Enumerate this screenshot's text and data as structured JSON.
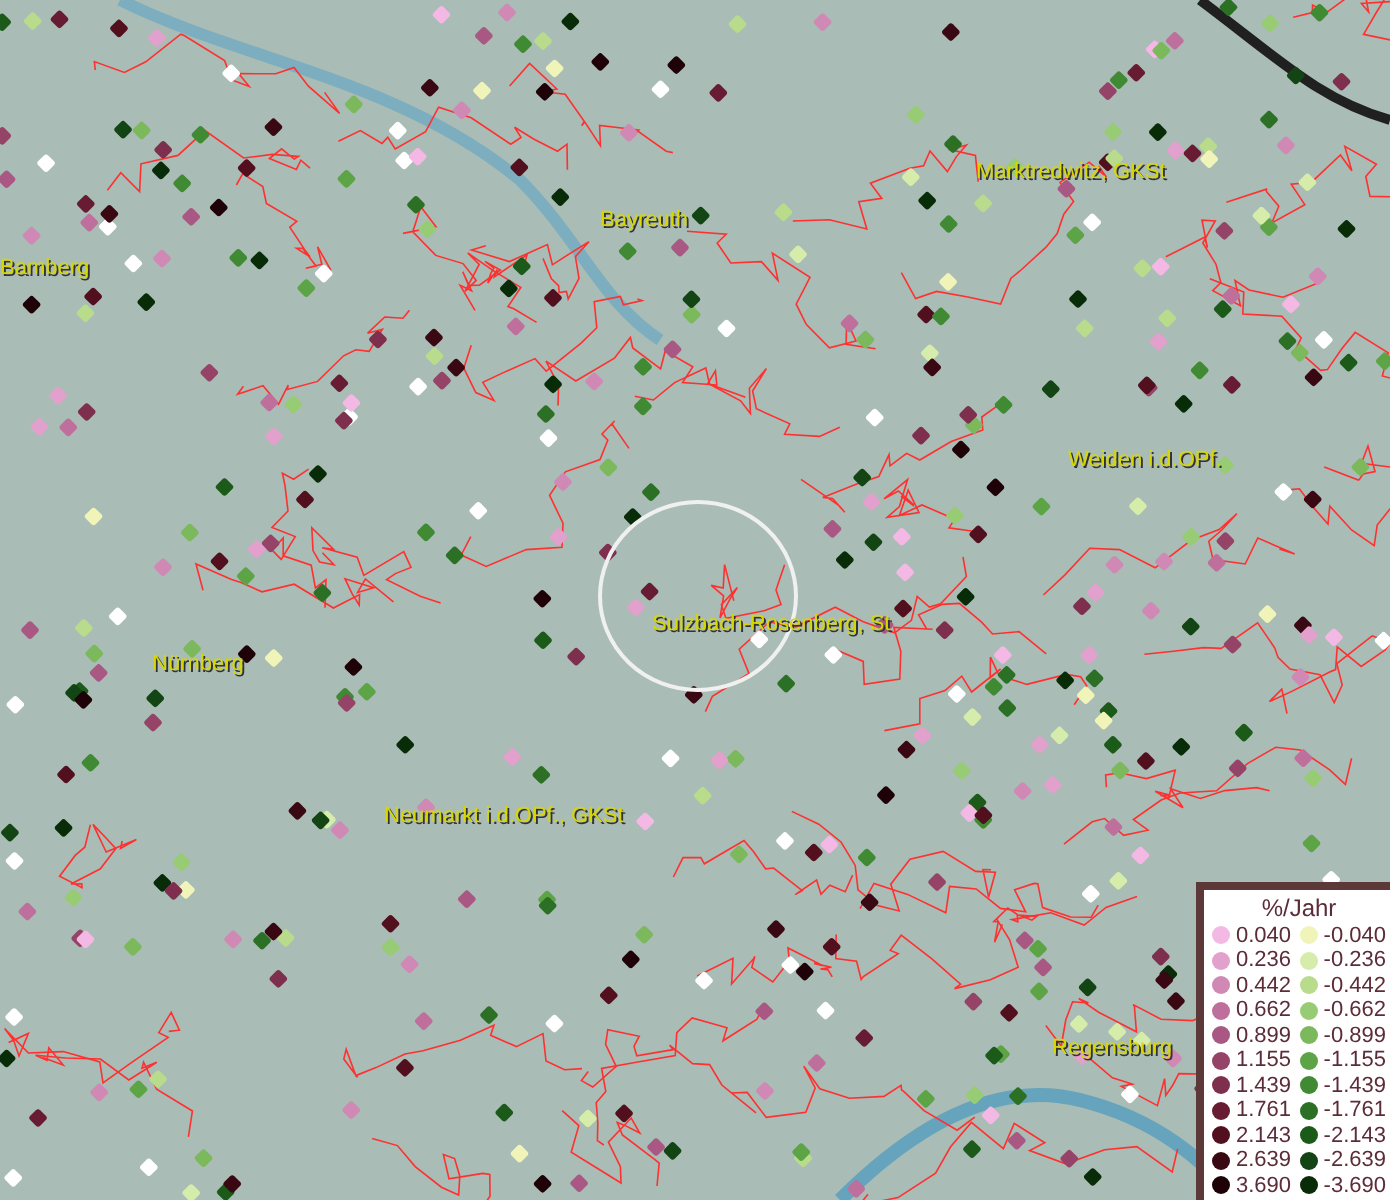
{
  "map": {
    "cities": [
      {
        "name": "Bamberg"
      },
      {
        "name": "Bayreuth"
      },
      {
        "name": "Marktredwitz, GKSt"
      },
      {
        "name": "Weiden i.d.OPf."
      },
      {
        "name": "Sulzbach-Rosenberg, St"
      },
      {
        "name": "Nürnberg"
      },
      {
        "name": "Neumarkt i.d.OPf., GKSt"
      },
      {
        "name": "Regensburg"
      }
    ]
  },
  "legend": {
    "title": "%/Jahr",
    "entries": [
      {
        "value": "0.040",
        "color": "#f4b8e4"
      },
      {
        "value": "-0.040",
        "color": "#f0f4b8"
      },
      {
        "value": "0.236",
        "color": "#e2a0cc"
      },
      {
        "value": "-0.236",
        "color": "#d6ecaa"
      },
      {
        "value": "0.442",
        "color": "#d088b4"
      },
      {
        "value": "-0.442",
        "color": "#b8dc8c"
      },
      {
        "value": "0.662",
        "color": "#bf6f9c"
      },
      {
        "value": "-0.662",
        "color": "#98cc74"
      },
      {
        "value": "0.899",
        "color": "#a85883"
      },
      {
        "value": "-0.899",
        "color": "#7cb85c"
      },
      {
        "value": "1.155",
        "color": "#954468"
      },
      {
        "value": "-1.155",
        "color": "#5ca446"
      },
      {
        "value": "1.439",
        "color": "#7e2f4d"
      },
      {
        "value": "-1.439",
        "color": "#3f8a32"
      },
      {
        "value": "1.761",
        "color": "#681c33"
      },
      {
        "value": "-1.761",
        "color": "#2c7026"
      },
      {
        "value": "2.143",
        "color": "#52101f"
      },
      {
        "value": "-2.143",
        "color": "#1c5a1a"
      },
      {
        "value": "2.639",
        "color": "#3a0812"
      },
      {
        "value": "-2.639",
        "color": "#124414"
      },
      {
        "value": "3.690",
        "color": "#1e0208"
      },
      {
        "value": "-3.690",
        "color": "#082c08"
      }
    ]
  }
}
